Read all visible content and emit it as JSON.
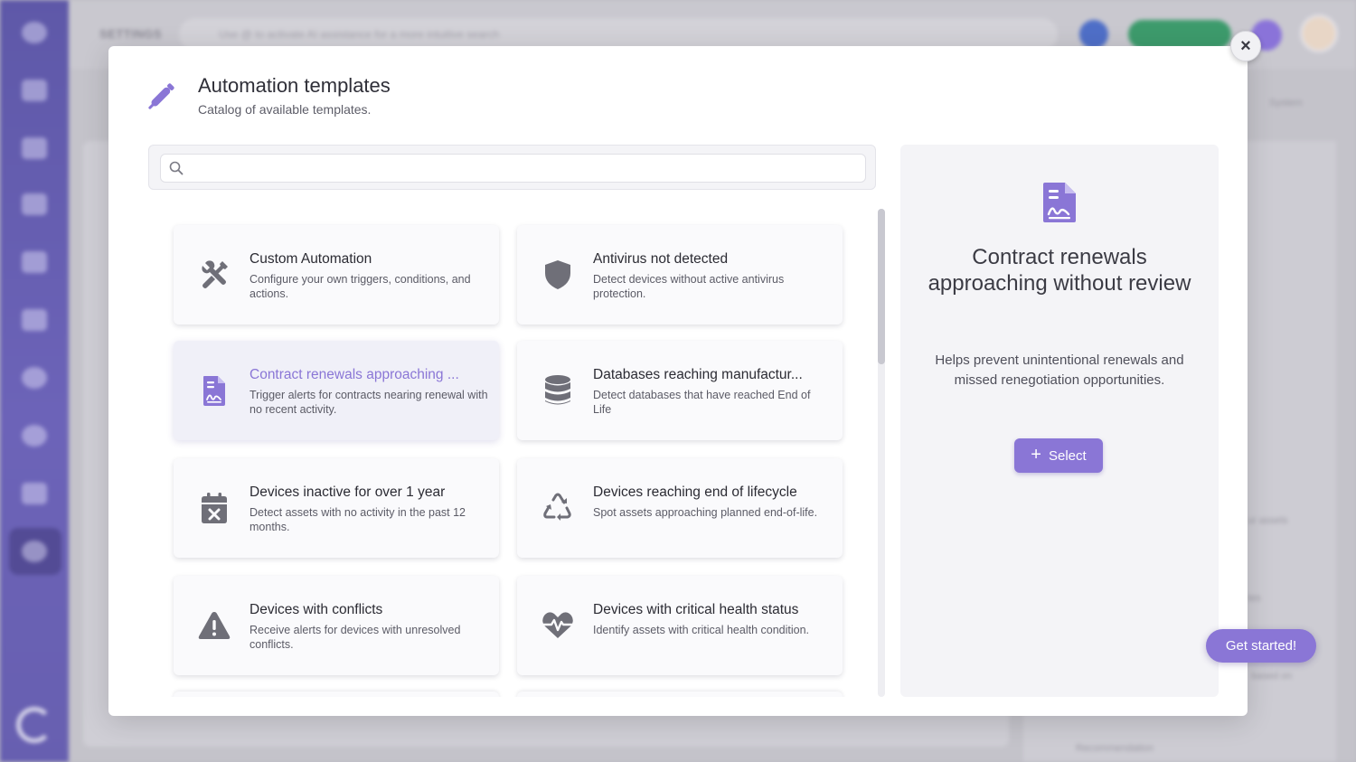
{
  "background": {
    "section": "SETTINGS",
    "search_placeholder": "Use @ to activate AI assistance for a more intuitive search",
    "right_labels": [
      "System",
      "ur assets",
      "tes",
      "based on",
      "Recommendation"
    ]
  },
  "modal": {
    "title": "Automation templates",
    "subtitle": "Catalog of available templates.",
    "close_label": "×",
    "search": {
      "placeholder": "",
      "value": ""
    },
    "templates": [
      {
        "title": "Custom Automation",
        "description": "Configure your own triggers, conditions, and actions.",
        "icon": "tools-icon",
        "selected": false
      },
      {
        "title": "Antivirus not detected",
        "description": "Detect devices without active antivirus protection.",
        "icon": "shield-icon",
        "selected": false
      },
      {
        "title": "Contract renewals approaching ...",
        "description": "Trigger alerts for contracts nearing renewal with no recent activity.",
        "icon": "contract-icon",
        "selected": true
      },
      {
        "title": "Databases reaching manufactur...",
        "description": "Detect databases that have reached End of Life",
        "icon": "database-icon",
        "selected": false
      },
      {
        "title": "Devices inactive for over 1 year",
        "description": "Detect assets with no activity in the past 12 months.",
        "icon": "calendar-x-icon",
        "selected": false
      },
      {
        "title": "Devices reaching end of lifecycle",
        "description": "Spot assets approaching planned end-of-life.",
        "icon": "recycle-icon",
        "selected": false
      },
      {
        "title": "Devices with conflicts",
        "description": "Receive alerts for devices with unresolved conflicts.",
        "icon": "warning-icon",
        "selected": false
      },
      {
        "title": "Devices with critical health status",
        "description": "Identify assets with critical health condition.",
        "icon": "heartbeat-icon",
        "selected": false
      }
    ],
    "detail": {
      "title": "Contract renewals approaching without review",
      "description": "Helps prevent unintentional renewals and missed renegotiation opportunities.",
      "select_label": "Select",
      "icon": "contract-icon"
    }
  },
  "floating": {
    "get_started_label": "Get started!"
  },
  "colors": {
    "accent": "#8a76d6",
    "icon_gray": "#6f6f78",
    "sidebar": "#6c63b8"
  }
}
